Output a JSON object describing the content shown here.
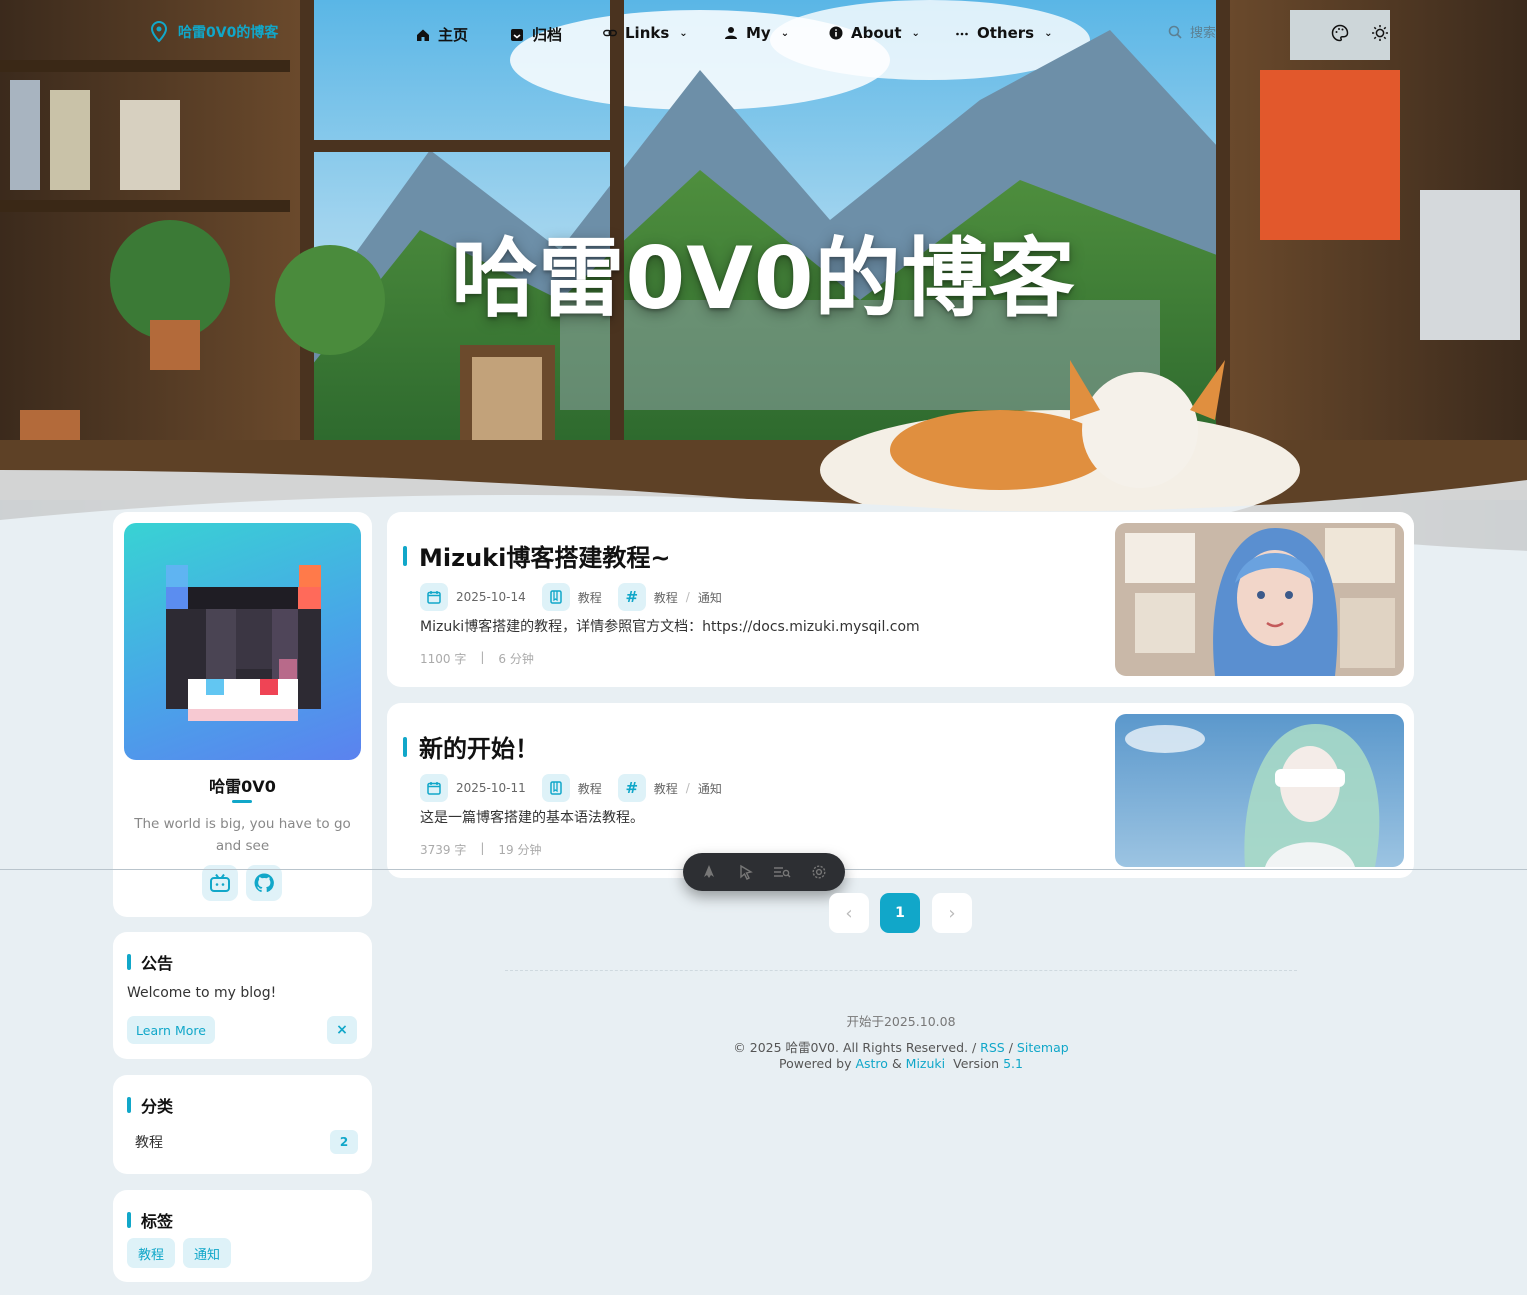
{
  "site": {
    "logo_text": "哈雷0V0的博客",
    "hero_title": "哈雷0V0的博客"
  },
  "nav": {
    "items": [
      {
        "label": "主页",
        "icon": "home-icon"
      },
      {
        "label": "归档",
        "icon": "archive-icon"
      },
      {
        "label": "Links",
        "icon": "link-icon",
        "dropdown": true
      },
      {
        "label": "My",
        "icon": "user-icon",
        "dropdown": true
      },
      {
        "label": "About",
        "icon": "info-icon",
        "dropdown": true
      },
      {
        "label": "Others",
        "icon": "more-icon",
        "dropdown": true
      }
    ],
    "search_placeholder": "搜索"
  },
  "profile": {
    "name": "哈雷0V0",
    "bio": "The world is big, you have to go and see",
    "socials": [
      "bilibili-icon",
      "github-icon"
    ]
  },
  "announcement": {
    "title": "公告",
    "text": "Welcome to my blog!",
    "button": "Learn More",
    "close": "×"
  },
  "categories": {
    "title": "分类",
    "items": [
      {
        "name": "教程",
        "count": "2"
      }
    ]
  },
  "tags": {
    "title": "标签",
    "items": [
      "教程",
      "通知"
    ]
  },
  "posts": [
    {
      "title": "Mizuki博客搭建教程~",
      "date": "2025-10-14",
      "category": "教程",
      "tags": [
        "教程",
        "通知"
      ],
      "desc": "Mizuki博客搭建的教程，详情参照官方文档：https://docs.mizuki.mysqil.com",
      "words": "1100 字",
      "divider": "|",
      "minutes": "6 分钟"
    },
    {
      "title": "新的开始！",
      "date": "2025-10-11",
      "category": "教程",
      "tags": [
        "教程",
        "通知"
      ],
      "desc": "这是一篇博客搭建的基本语法教程。",
      "words": "3739 字",
      "divider": "|",
      "minutes": "19 分钟"
    }
  ],
  "pagination": {
    "prev": "‹",
    "current": "1",
    "next": "›"
  },
  "footer": {
    "since": "开始于2025.10.08",
    "copyright": "© 2025 哈雷0V0. All Rights Reserved. /",
    "rss": "RSS",
    "slash": "/",
    "sitemap": "Sitemap",
    "powered_prefix": "Powered by",
    "astro": "Astro",
    "amp": "&",
    "mizuki": "Mizuki",
    "version_label": "Version",
    "version": "5.1"
  },
  "colors": {
    "accent": "#11a7c9",
    "background": "#e8eff3",
    "card": "#ffffff"
  }
}
